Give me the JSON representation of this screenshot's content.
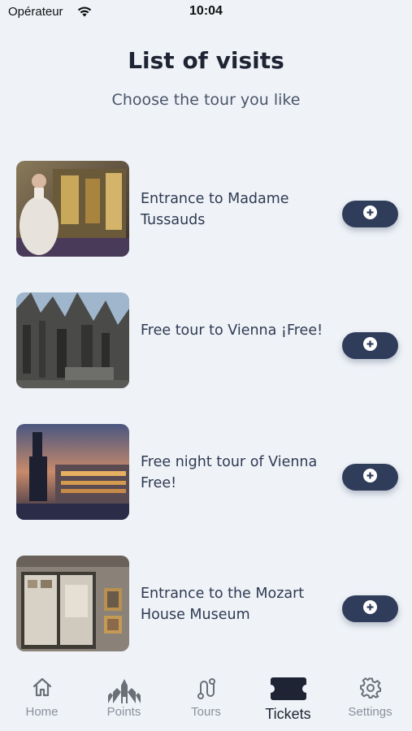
{
  "status_bar": {
    "carrier": "Opérateur",
    "time": "10:04"
  },
  "header": {
    "title": "List of visits",
    "subtitle": "Choose the tour you like"
  },
  "visits": [
    {
      "title": "Entrance to Madame Tussauds",
      "add_icon": "plus-circle-icon"
    },
    {
      "title": "Free tour to Vienna ¡Free!",
      "add_icon": "plus-circle-icon"
    },
    {
      "title": "Free night tour of Vienna Free!",
      "add_icon": "plus-circle-icon"
    },
    {
      "title": "Entrance to the Mozart House Museum",
      "add_icon": "plus-circle-icon"
    }
  ],
  "tabs": [
    {
      "label": "Home",
      "icon": "home-icon",
      "active": false
    },
    {
      "label": "Points",
      "icon": "church-icon",
      "active": false
    },
    {
      "label": "Tours",
      "icon": "route-icon",
      "active": false
    },
    {
      "label": "Tickets",
      "icon": "ticket-icon",
      "active": true
    },
    {
      "label": "Settings",
      "icon": "gear-icon",
      "active": false
    }
  ],
  "colors": {
    "background": "#eff3f8",
    "accent": "#2f3c5a",
    "text": "#2f3a52",
    "inactive_tab": "#8a8f99"
  }
}
